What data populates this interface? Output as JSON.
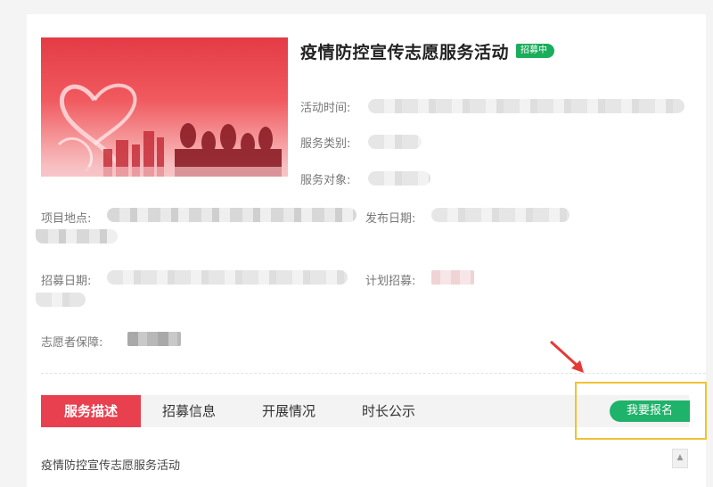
{
  "activity": {
    "title": "疫情防控宣传志愿服务活动",
    "status_badge": "招募中",
    "fields": {
      "time_label": "活动时间:",
      "category_label": "服务类别:",
      "target_label": "服务对象:",
      "location_label": "项目地点:",
      "publish_label": "发布日期:",
      "recruit_date_label": "招募日期:",
      "plan_label": "计划招募:",
      "guarantee_label": "志愿者保障:"
    }
  },
  "tabs": [
    {
      "label": "服务描述",
      "active": true
    },
    {
      "label": "招募信息",
      "active": false
    },
    {
      "label": "开展情况",
      "active": false
    },
    {
      "label": "时长公示",
      "active": false
    }
  ],
  "signup_button": "我要报名",
  "description": "疫情防控宣传志愿服务活动",
  "colors": {
    "accent_red": "#e8404f",
    "badge_green": "#1aad5c",
    "button_green": "#1fb26a",
    "highlight_border": "#f1c232",
    "arrow_red": "#e53935"
  }
}
